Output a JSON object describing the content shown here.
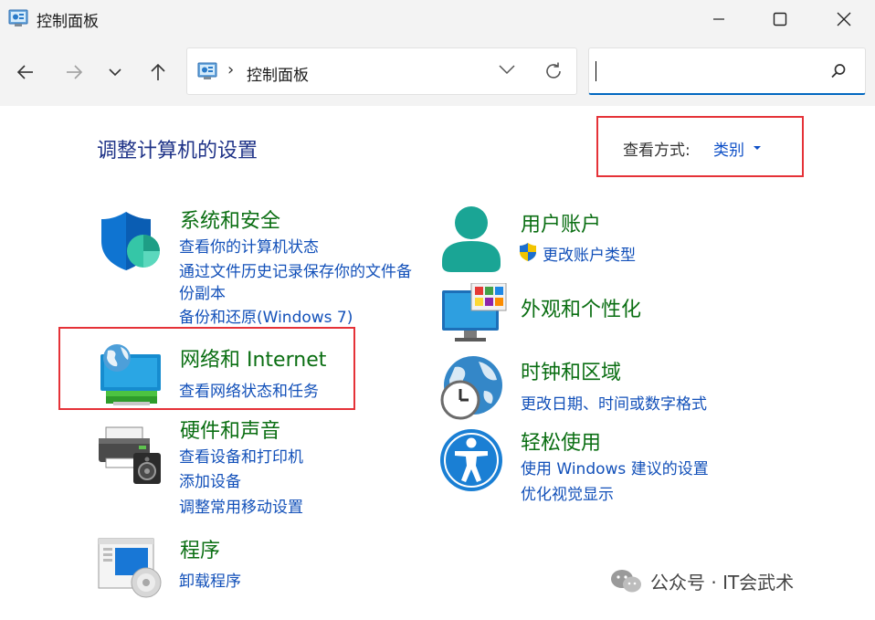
{
  "window": {
    "title": "控制面板"
  },
  "nav": {
    "breadcrumb_sep": "›",
    "breadcrumb": "控制面板",
    "search_value": ""
  },
  "main": {
    "heading": "调整计算机的设置",
    "view_by_label": "查看方式:",
    "view_by_value": "类别"
  },
  "categories": {
    "system_security": {
      "title": "系统和安全",
      "links": [
        "查看你的计算机状态",
        "通过文件历史记录保存你的文件备",
        "份副本",
        "备份和还原(Windows 7)"
      ],
      "icon": "shield-icon"
    },
    "network": {
      "title": "网络和 Internet",
      "links": [
        "查看网络状态和任务"
      ],
      "icon": "network-globe-icon"
    },
    "hardware": {
      "title": "硬件和声音",
      "links": [
        "查看设备和打印机",
        "添加设备",
        "调整常用移动设置"
      ],
      "icon": "printer-speaker-icon"
    },
    "programs": {
      "title": "程序",
      "links": [
        "卸载程序"
      ],
      "icon": "programs-disc-icon"
    },
    "user_accounts": {
      "title": "用户账户",
      "links": [
        "更改账户类型"
      ],
      "icon": "user-icon"
    },
    "appearance": {
      "title": "外观和个性化",
      "links": [],
      "icon": "monitor-palette-icon"
    },
    "clock_region": {
      "title": "时钟和区域",
      "links": [
        "更改日期、时间或数字格式"
      ],
      "icon": "globe-clock-icon"
    },
    "ease_access": {
      "title": "轻松使用",
      "links": [
        "使用 Windows 建议的设置",
        "优化视觉显示"
      ],
      "icon": "accessibility-icon"
    }
  },
  "watermark": {
    "text": "公众号 · IT会武术"
  },
  "colors": {
    "category_title": "#0a6e12",
    "link": "#1250b9",
    "heading": "#1e3287",
    "highlight_box": "#e53238"
  }
}
